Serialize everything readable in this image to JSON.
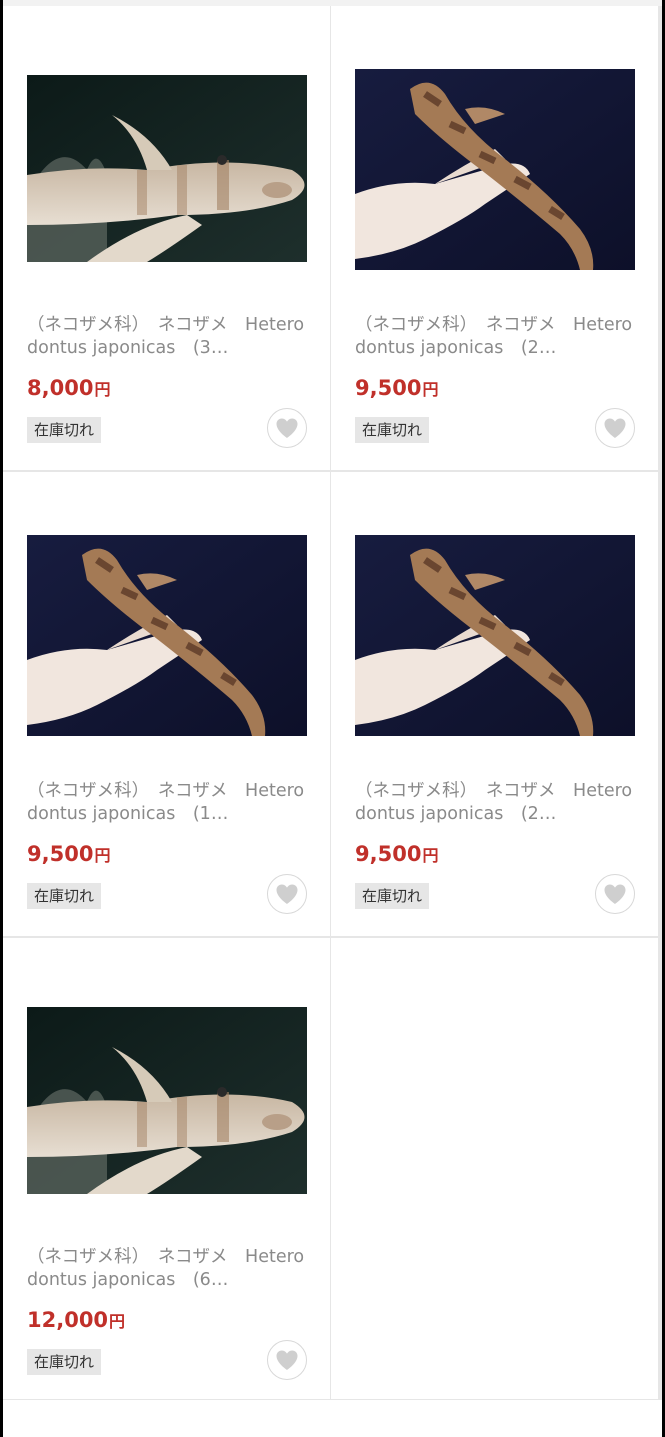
{
  "products": [
    {
      "title": "（ネコザメ科）　ネコザメ　Heterodontus japonicas　(3…",
      "price": "8,000",
      "currency": "円",
      "stock_status": "在庫切れ",
      "image_kind": "aquarium",
      "favorite_icon": "heart-icon"
    },
    {
      "title": "（ネコザメ科）　ネコザメ　Heterodontus japonicas　(2…",
      "price": "9,500",
      "currency": "円",
      "stock_status": "在庫切れ",
      "image_kind": "hand",
      "favorite_icon": "heart-icon"
    },
    {
      "title": "（ネコザメ科）　ネコザメ　Heterodontus japonicas　(1…",
      "price": "9,500",
      "currency": "円",
      "stock_status": "在庫切れ",
      "image_kind": "hand",
      "favorite_icon": "heart-icon"
    },
    {
      "title": "（ネコザメ科）　ネコザメ　Heterodontus japonicas　(2…",
      "price": "9,500",
      "currency": "円",
      "stock_status": "在庫切れ",
      "image_kind": "hand",
      "favorite_icon": "heart-icon"
    },
    {
      "title": "（ネコザメ科）　ネコザメ　Heterodontus japonicas　(6…",
      "price": "12,000",
      "currency": "円",
      "stock_status": "在庫切れ",
      "image_kind": "aquarium",
      "favorite_icon": "heart-icon"
    }
  ],
  "colors": {
    "price": "#c0302a",
    "badge_bg": "#e6e6e6",
    "title": "#8a8a8a",
    "heart": "#cfcfcf"
  }
}
